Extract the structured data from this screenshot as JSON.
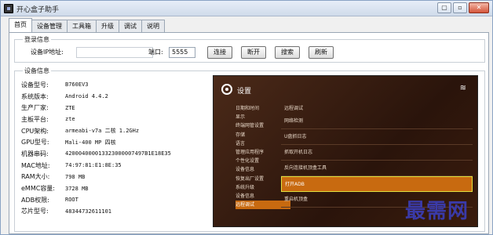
{
  "window": {
    "title": "开心盒子助手",
    "buttons": [
      "▢",
      "▫",
      "✕"
    ]
  },
  "tabs": [
    "首页",
    "设备管理",
    "工具箱",
    "升级",
    "调试",
    "说明"
  ],
  "login": {
    "group_title": "登录信息",
    "ip_label": "设备IP地址:",
    "ip_value": "",
    "port_label": "端口:",
    "port_value": "5555",
    "buttons": [
      "连接",
      "断开",
      "搜索",
      "刷新"
    ]
  },
  "device": {
    "group_title": "设备信息",
    "rows": [
      {
        "key": "设备型号:",
        "value": "B760EV3"
      },
      {
        "key": "系统版本:",
        "value": "Android 4.4.2"
      },
      {
        "key": "生产厂家:",
        "value": "ZTE"
      },
      {
        "key": "主板平台:",
        "value": "zte"
      },
      {
        "key": "CPU架构:",
        "value": "armeabi-v7a 二核 1.2GHz"
      },
      {
        "key": "GPU型号:",
        "value": "Mali-400 MP 四核"
      },
      {
        "key": "机器串码:",
        "value": "420004000013323000007497B1E18E35"
      },
      {
        "key": "MAC地址:",
        "value": "74:97:81:E1:8E:35"
      },
      {
        "key": "RAM大小:",
        "value": "798 MB"
      },
      {
        "key": "eMMC容量:",
        "value": "3728 MB"
      },
      {
        "key": "ADB权限:",
        "value": "ROOT"
      },
      {
        "key": "芯片型号:",
        "value": "48344732611101"
      }
    ]
  },
  "tv": {
    "title": "设置",
    "wifi_icon": "≋",
    "left_items": [
      "日期和时间",
      "显示",
      "终端网管设置",
      "存储",
      "语言",
      "管理应用程序",
      "个性化设置",
      "设备信息",
      "恢复出厂设置",
      "系统升级",
      "设备信息",
      "远程调试"
    ],
    "left_selected": 11,
    "right_header": "远程调试",
    "right_items": [
      "网络检测",
      "U盘抓日志",
      "抓取开机日志",
      "反向连接机顶盒工具",
      "打开ADB",
      "重启机顶盒"
    ],
    "right_selected": 4
  },
  "watermark": "最需网"
}
